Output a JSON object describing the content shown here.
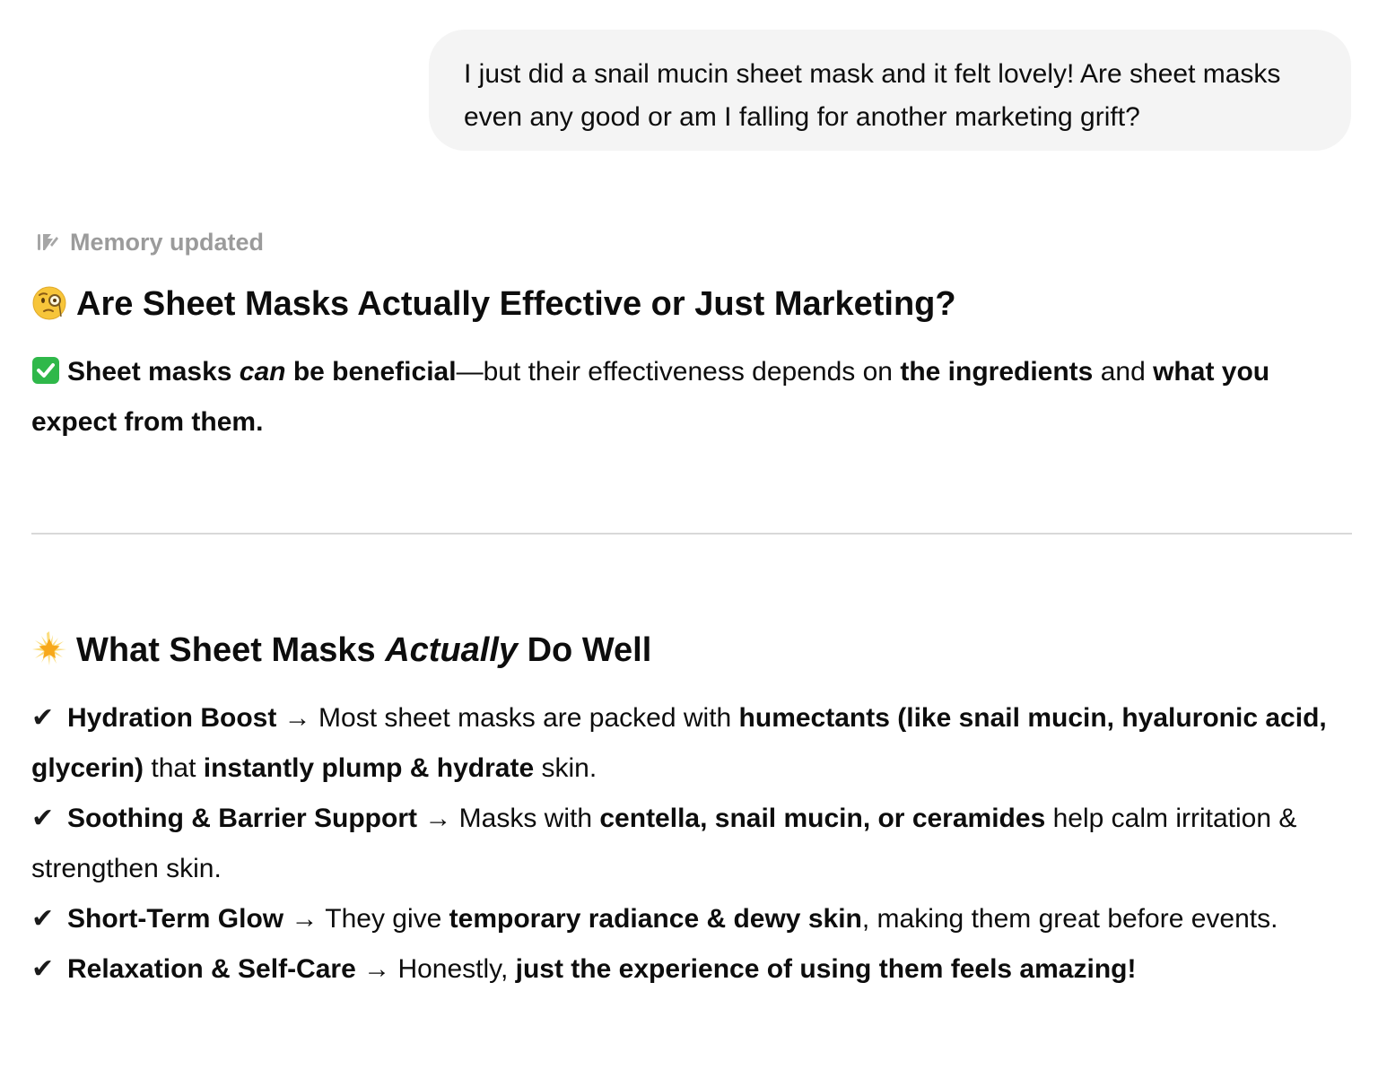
{
  "user_message": {
    "text": "I just did a snail mucin sheet mask and it felt lovely! Are sheet masks even any good or am I falling for another marketing grift?"
  },
  "memory": {
    "icon": "memory-edit-icon",
    "label": "Memory updated"
  },
  "heading_main": {
    "emoji": "monocle-face-emoji",
    "text": "Are Sheet Masks Actually Effective or Just Marketing?"
  },
  "intro": {
    "emoji": "green-check-box-emoji",
    "bold1a": "Sheet masks ",
    "bold_italic": "can",
    "bold1b": " be beneficial",
    "text1": "—but their effectiveness depends on ",
    "bold2": "the ingredients",
    "text2": " and ",
    "bold3": "what you expect from them."
  },
  "heading_second": {
    "emoji": "glowing-star-emoji",
    "text_before": "What Sheet Masks ",
    "text_italic": "Actually",
    "text_after": " Do Well"
  },
  "benefits": [
    {
      "tick": "✔",
      "title": "Hydration Boost",
      "arrow": " → ",
      "t1": "Most sheet masks are packed with ",
      "b1": "humectants (like snail mucin, hyaluronic acid, glycerin)",
      "t2": " that ",
      "b2": "instantly plump & hydrate",
      "t3": " skin."
    },
    {
      "tick": "✔",
      "title": "Soothing & Barrier Support",
      "arrow": " → ",
      "t1": "Masks with ",
      "b1": "centella, snail mucin, or ceramides",
      "t2": " help calm irritation & strengthen skin."
    },
    {
      "tick": "✔",
      "title": "Short-Term Glow",
      "arrow": " → ",
      "t1": "They give ",
      "b1": "temporary radiance & dewy skin",
      "t2": ", making them great before events."
    },
    {
      "tick": "✔",
      "title": "Relaxation & Self-Care",
      "arrow": " → ",
      "t1": "Honestly, ",
      "b1": "just the experience of using them feels amazing!"
    }
  ],
  "colors": {
    "bubble_bg": "#f4f4f4",
    "muted_text": "#9b9b9b",
    "divider": "#d9d9d9",
    "check_green": "#2fb84a"
  }
}
